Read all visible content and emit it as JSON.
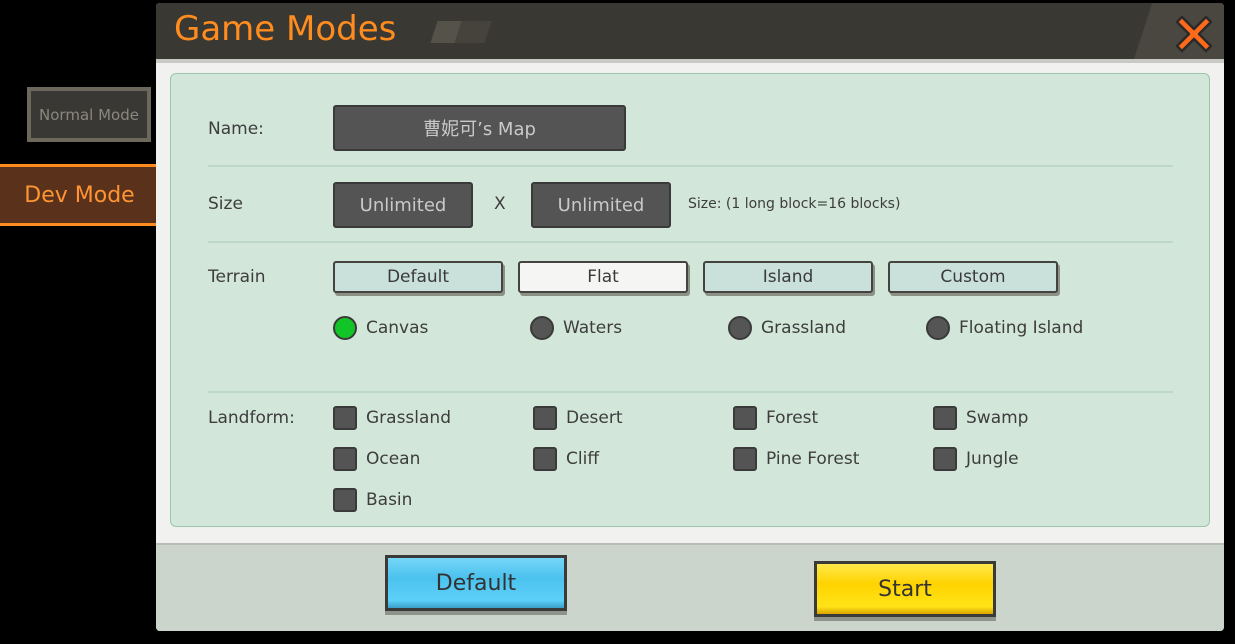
{
  "sidebar": {
    "tabs": [
      {
        "label": "Normal Mode",
        "selected": false
      },
      {
        "label": "Dev Mode",
        "selected": true
      }
    ]
  },
  "dialog": {
    "title": "Game Modes",
    "close_icon": "close-x-icon"
  },
  "form": {
    "name": {
      "label": "Name:",
      "value": "曹妮可’s Map"
    },
    "size": {
      "label": "Size",
      "width_value": "Unlimited",
      "separator": "X",
      "height_value": "Unlimited",
      "hint": "Size: (1 long block=16 blocks)"
    },
    "terrain": {
      "label": "Terrain",
      "buttons": [
        {
          "label": "Default",
          "selected": false
        },
        {
          "label": "Flat",
          "selected": true
        },
        {
          "label": "Island",
          "selected": false
        },
        {
          "label": "Custom",
          "selected": false
        }
      ],
      "options": [
        {
          "label": "Canvas",
          "selected": true
        },
        {
          "label": "Waters",
          "selected": false
        },
        {
          "label": "Grassland",
          "selected": false
        },
        {
          "label": "Floating Island",
          "selected": false
        }
      ]
    },
    "landform": {
      "label": "Landform:",
      "options": [
        {
          "label": "Grassland",
          "checked": false
        },
        {
          "label": "Desert",
          "checked": false
        },
        {
          "label": "Forest",
          "checked": false
        },
        {
          "label": "Swamp",
          "checked": false
        },
        {
          "label": "Ocean",
          "checked": false
        },
        {
          "label": "Cliff",
          "checked": false
        },
        {
          "label": "Pine Forest",
          "checked": false
        },
        {
          "label": "Jungle",
          "checked": false
        },
        {
          "label": "Basin",
          "checked": false
        }
      ]
    }
  },
  "footer": {
    "default_label": "Default",
    "start_label": "Start"
  },
  "colors": {
    "accent_orange": "#ff8c1f",
    "radio_selected": "#12c428",
    "default_button": "#4bc2ee",
    "start_button": "#ffd300"
  }
}
